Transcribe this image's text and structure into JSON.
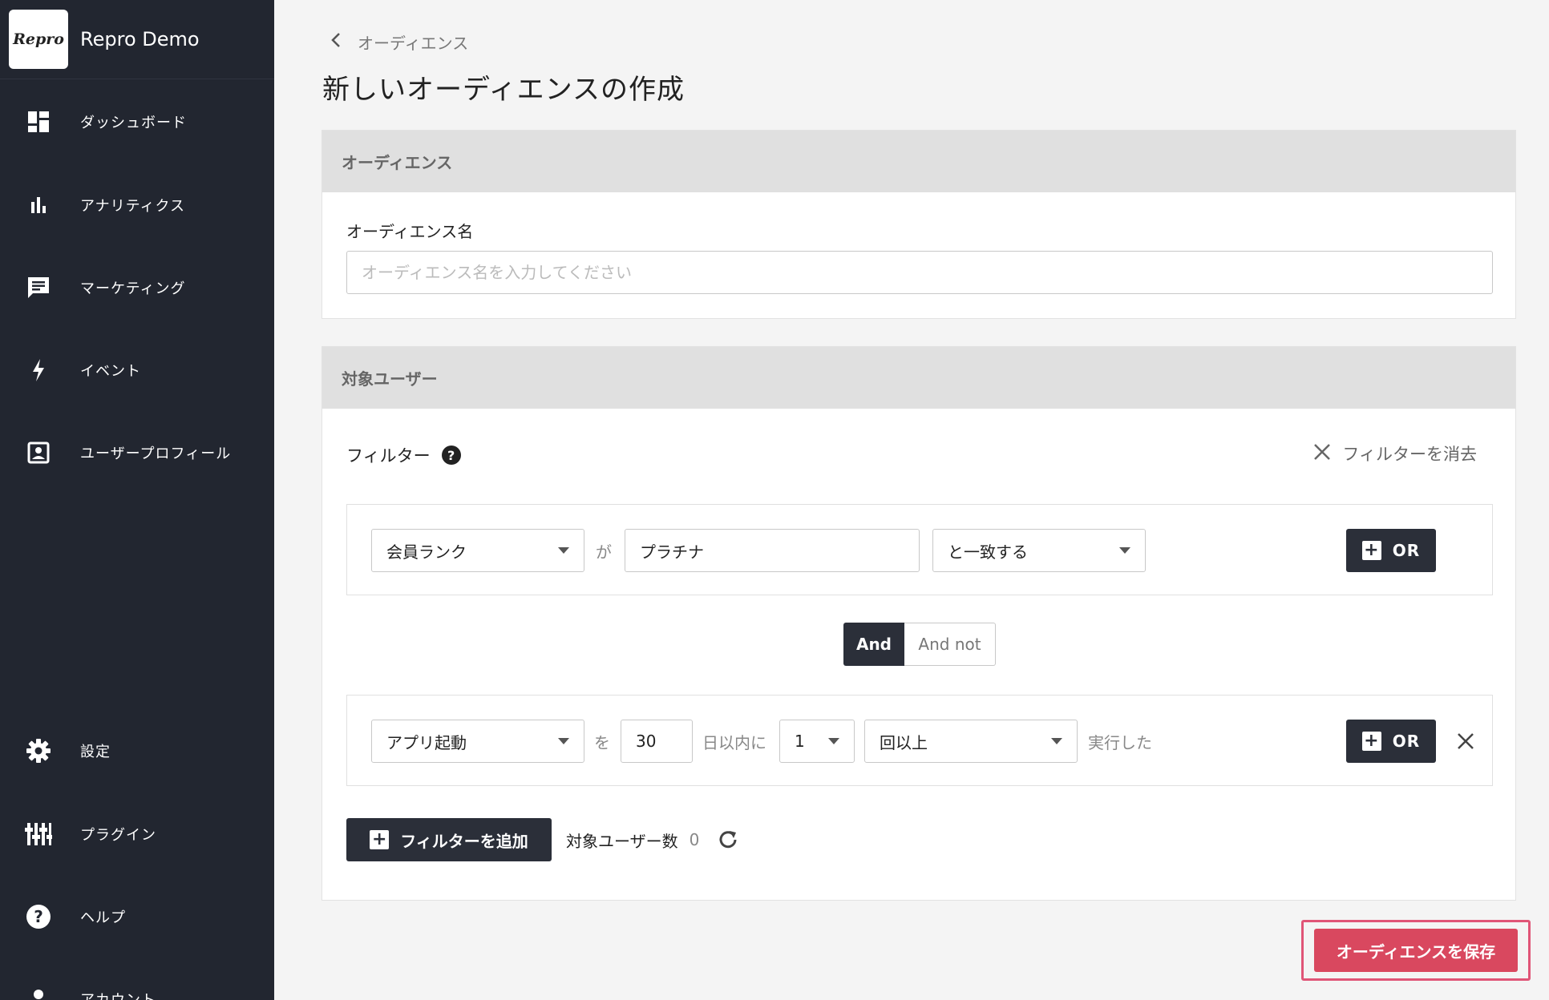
{
  "sidebar": {
    "logo_text": "Repro",
    "app_name": "Repro Demo",
    "items": [
      {
        "label": "ダッシュボード",
        "icon": "dashboard-icon"
      },
      {
        "label": "アナリティクス",
        "icon": "bar-chart-icon"
      },
      {
        "label": "マーケティング",
        "icon": "chat-icon"
      },
      {
        "label": "イベント",
        "icon": "bolt-icon"
      },
      {
        "label": "ユーザープロフィール",
        "icon": "profile-icon"
      }
    ],
    "bottom_items": [
      {
        "label": "設定",
        "icon": "gear-icon"
      },
      {
        "label": "プラグイン",
        "icon": "plugin-icon"
      },
      {
        "label": "ヘルプ",
        "icon": "help-icon"
      },
      {
        "label": "アカウント",
        "icon": "account-icon"
      }
    ]
  },
  "breadcrumb": {
    "label": "オーディエンス"
  },
  "page_title": "新しいオーディエンスの作成",
  "audience_panel": {
    "header": "オーディエンス",
    "name_label": "オーディエンス名",
    "name_value": "",
    "name_placeholder": "オーディエンス名を入力してください"
  },
  "target_panel": {
    "header": "対象ユーザー",
    "filter_label": "フィルター",
    "help_symbol": "?",
    "clear_filter_label": "フィルターを消去",
    "condition1": {
      "attribute": "会員ランク",
      "connector": "が",
      "value": "プラチナ",
      "operator": "と一致する",
      "or_label": "OR"
    },
    "logic_toggle": {
      "and_label": "And",
      "and_not_label": "And not",
      "selected": "And"
    },
    "condition2": {
      "event": "アプリ起動",
      "connector_wo": "を",
      "days": "30",
      "days_suffix": "日以内に",
      "count": "1",
      "count_operator": "回以上",
      "suffix": "実行した",
      "or_label": "OR"
    },
    "add_filter_label": "フィルターを追加",
    "user_count_label": "対象ユーザー数",
    "user_count_value": "0"
  },
  "save_button_label": "オーディエンスを保存",
  "colors": {
    "sidebar_bg": "#222630",
    "primary_dark": "#2b2f39",
    "save_red": "#d9485f",
    "highlight_pink": "#e05577"
  }
}
